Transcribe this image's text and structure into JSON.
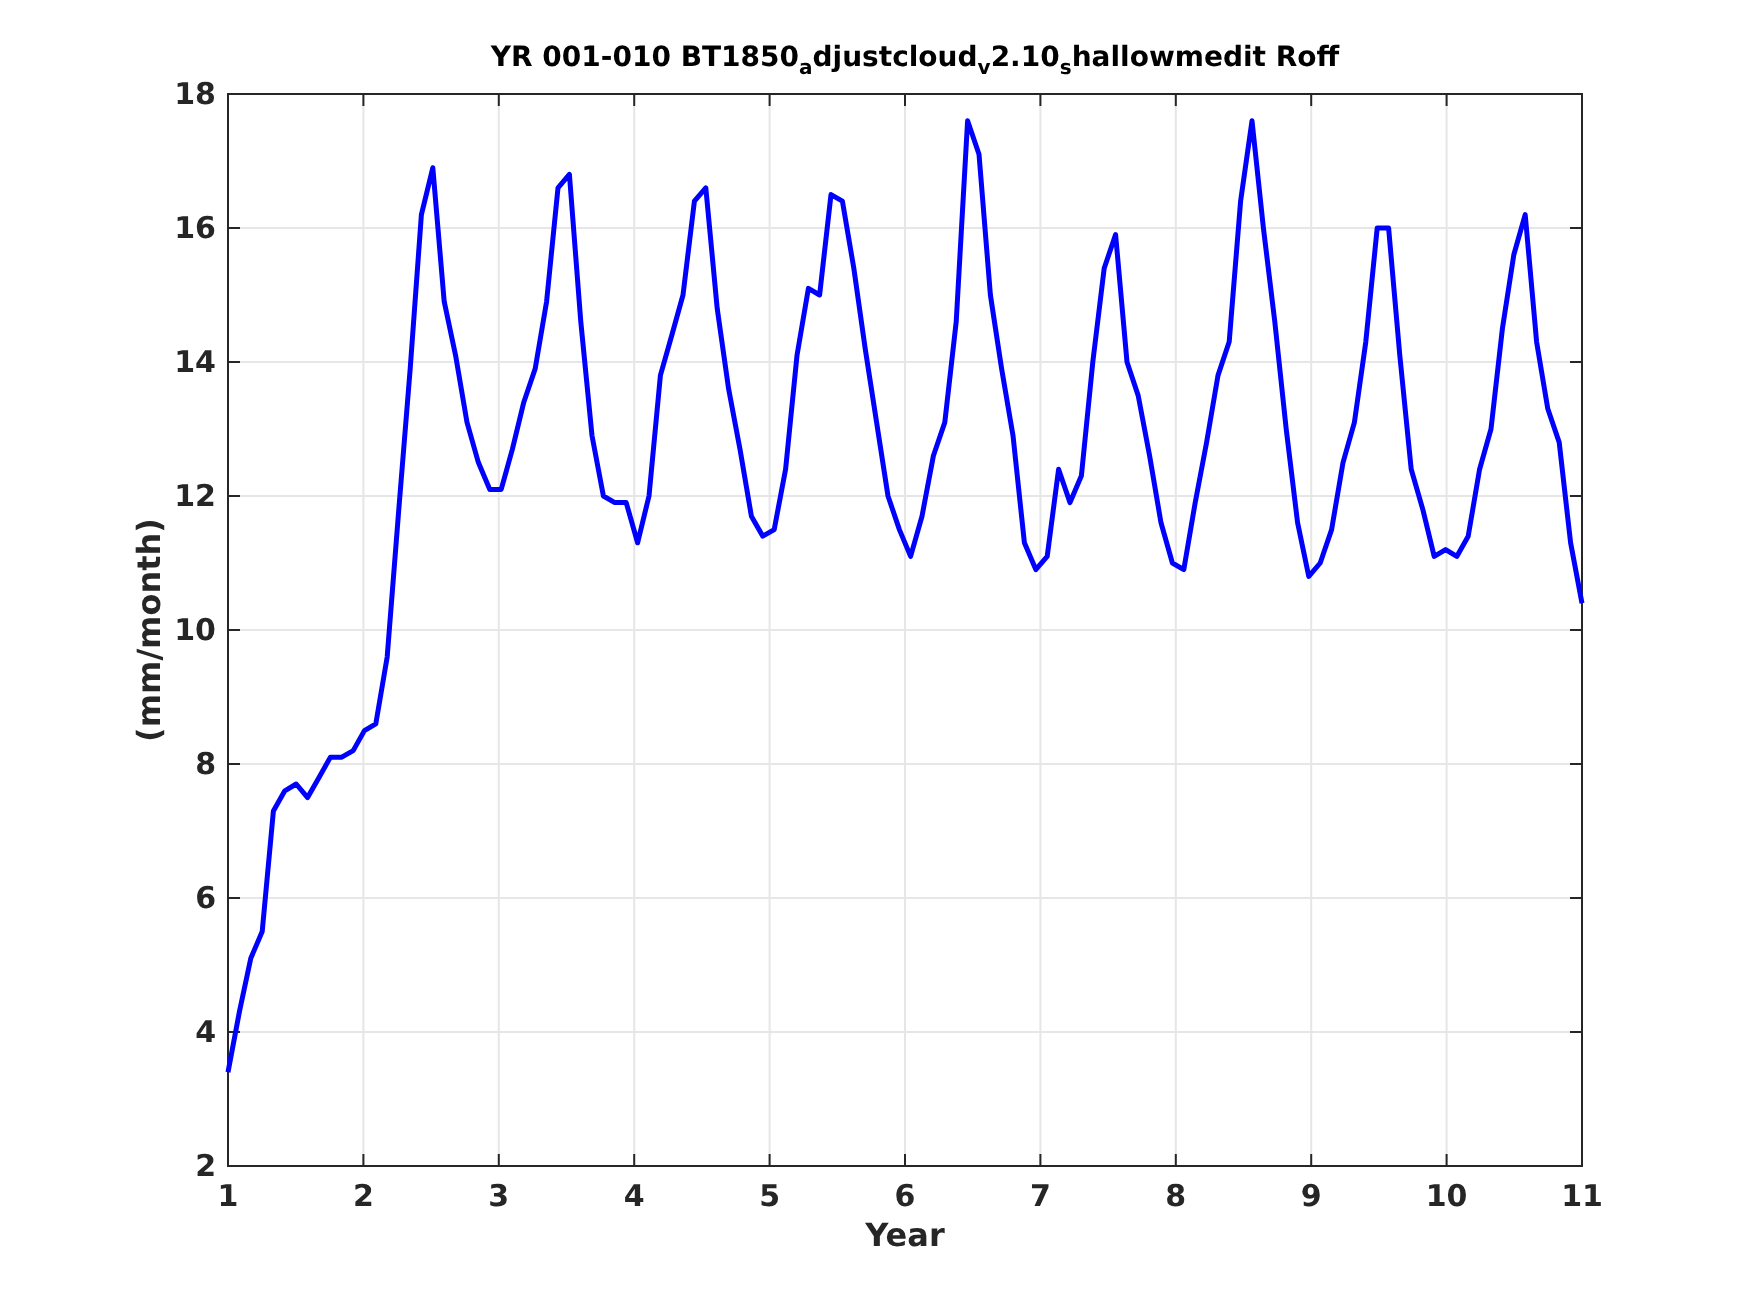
{
  "figure": {
    "chart_data": {
      "type": "line",
      "title": "YR 001-010 BT1850$_{a}$djustcloud$_{v}$2.10$_{s}$hallowmedit Roff",
      "xlabel": "Year",
      "ylabel": "(mm/month)",
      "xlim": [
        1,
        11
      ],
      "grid": true,
      "x": [
        1,
        1.084,
        1.168,
        1.252,
        1.336,
        1.42,
        1.504,
        1.588,
        1.672,
        1.756,
        1.84,
        1.924,
        2.008,
        2.092,
        2.176,
        2.261,
        2.345,
        2.429,
        2.513,
        2.597,
        2.681,
        2.765,
        2.849,
        2.933,
        3.017,
        3.101,
        3.185,
        3.269,
        3.353,
        3.437,
        3.521,
        3.605,
        3.689,
        3.773,
        3.857,
        3.941,
        4.025,
        4.109,
        4.193,
        4.277,
        4.361,
        4.445,
        4.529,
        4.613,
        4.697,
        4.782,
        4.866,
        4.95,
        5.034,
        5.118,
        5.202,
        5.286,
        5.37,
        5.454,
        5.538,
        5.622,
        5.706,
        5.79,
        5.874,
        5.958,
        6.042,
        6.126,
        6.21,
        6.294,
        6.378,
        6.462,
        6.546,
        6.63,
        6.714,
        6.798,
        6.882,
        6.966,
        7.05,
        7.134,
        7.218,
        7.303,
        7.387,
        7.471,
        7.555,
        7.639,
        7.723,
        7.807,
        7.891,
        7.975,
        8.059,
        8.143,
        8.227,
        8.311,
        8.395,
        8.479,
        8.563,
        8.647,
        8.731,
        8.815,
        8.899,
        8.983,
        9.067,
        9.151,
        9.235,
        9.319,
        9.403,
        9.487,
        9.571,
        9.655,
        9.739,
        9.824,
        9.908,
        9.992,
        10.076,
        10.16,
        10.244,
        10.328,
        10.412,
        10.496,
        10.58,
        10.664,
        10.748,
        10.832,
        10.916,
        11
      ],
      "ylim": [
        2,
        18
      ],
      "xticks": [
        1,
        2,
        3,
        4,
        5,
        6,
        7,
        8,
        9,
        10,
        11
      ],
      "yticks": [
        2,
        4,
        6,
        8,
        10,
        12,
        14,
        16,
        18
      ],
      "series": [
        {
          "color": "#0000ff",
          "values": [
            3.4,
            4.3,
            5.1,
            5.5,
            7.3,
            7.6,
            7.7,
            7.5,
            7.8,
            8.1,
            8.1,
            8.2,
            8.5,
            8.6,
            9.6,
            11.8,
            13.9,
            16.2,
            16.9,
            14.9,
            14.1,
            13.1,
            12.5,
            12.1,
            12.1,
            12.7,
            13.4,
            13.9,
            14.9,
            16.6,
            16.8,
            14.6,
            12.9,
            12.0,
            11.9,
            11.9,
            11.3,
            12.0,
            13.8,
            14.4,
            15.0,
            16.4,
            16.6,
            14.8,
            13.6,
            12.7,
            11.7,
            11.4,
            11.5,
            12.4,
            14.1,
            15.1,
            15.0,
            16.5,
            16.4,
            15.4,
            14.2,
            13.1,
            12.0,
            11.5,
            11.1,
            11.7,
            12.6,
            13.1,
            14.6,
            17.6,
            17.1,
            15.0,
            13.9,
            12.9,
            11.3,
            10.9,
            11.1,
            12.4,
            11.9,
            12.3,
            14.0,
            15.4,
            15.9,
            14.0,
            13.5,
            12.6,
            11.6,
            11.0,
            10.9,
            11.9,
            12.8,
            13.8,
            14.3,
            16.4,
            17.6,
            16.0,
            14.6,
            13.0,
            11.6,
            10.8,
            11.0,
            11.5,
            12.5,
            13.1,
            14.3,
            16.0,
            16.0,
            14.1,
            12.4,
            11.8,
            11.1,
            11.2,
            11.1,
            11.4,
            12.4,
            13.0,
            14.5,
            15.6,
            16.2,
            14.3,
            13.3,
            12.8,
            11.3,
            10.4
          ]
        }
      ]
    }
  }
}
